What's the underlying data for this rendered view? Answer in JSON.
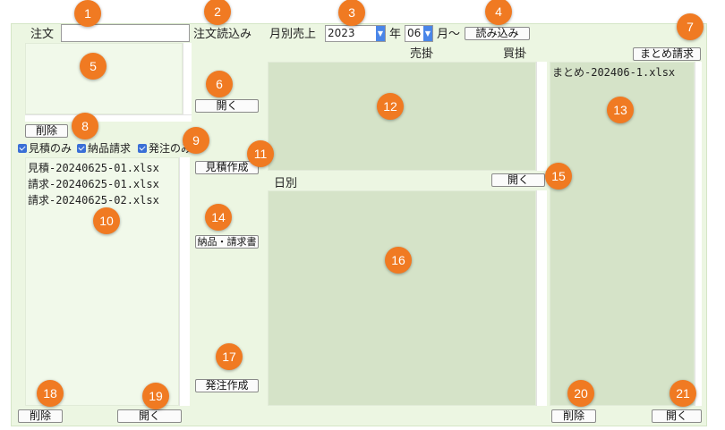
{
  "order": {
    "label": "注文",
    "value": "",
    "load_label": "注文読込み"
  },
  "monthly": {
    "label": "月別売上",
    "year": "2023",
    "year_unit": "年",
    "month": "06",
    "month_unit": "月〜",
    "load_label": "読み込み"
  },
  "order_list": {
    "delete_label": "削除",
    "open_label": "開く"
  },
  "filters": [
    {
      "label": "見積のみ",
      "checked": true
    },
    {
      "label": "納品請求",
      "checked": true
    },
    {
      "label": "発注のみ",
      "checked": true
    }
  ],
  "files": [
    "見積-20240625-01.xlsx",
    "請求-20240625-01.xlsx",
    "請求-20240625-02.xlsx"
  ],
  "file_actions": {
    "quote_label": "見積作成",
    "delivery_invoice_label": "納品・請求書",
    "purchase_order_label": "発注作成",
    "delete_label": "削除",
    "open_label": "開く"
  },
  "sales": {
    "receivable_label": "売掛",
    "payable_label": "買掛",
    "open_label": "開く"
  },
  "daily": {
    "label": "日別"
  },
  "summary": {
    "label": "まとめ請求",
    "files": [
      "まとめ-202406-1.xlsx"
    ],
    "delete_label": "削除",
    "open_label": "開く"
  },
  "markers": [
    "1",
    "2",
    "3",
    "4",
    "5",
    "6",
    "7",
    "8",
    "9",
    "10",
    "11",
    "12",
    "13",
    "14",
    "15",
    "16",
    "17",
    "18",
    "19",
    "20",
    "21"
  ],
  "colors": {
    "panel": "#ecf6e2",
    "list_dark": "#d5e3c8",
    "badge": "#f07a22",
    "checkbox": "#3a6fd6"
  }
}
